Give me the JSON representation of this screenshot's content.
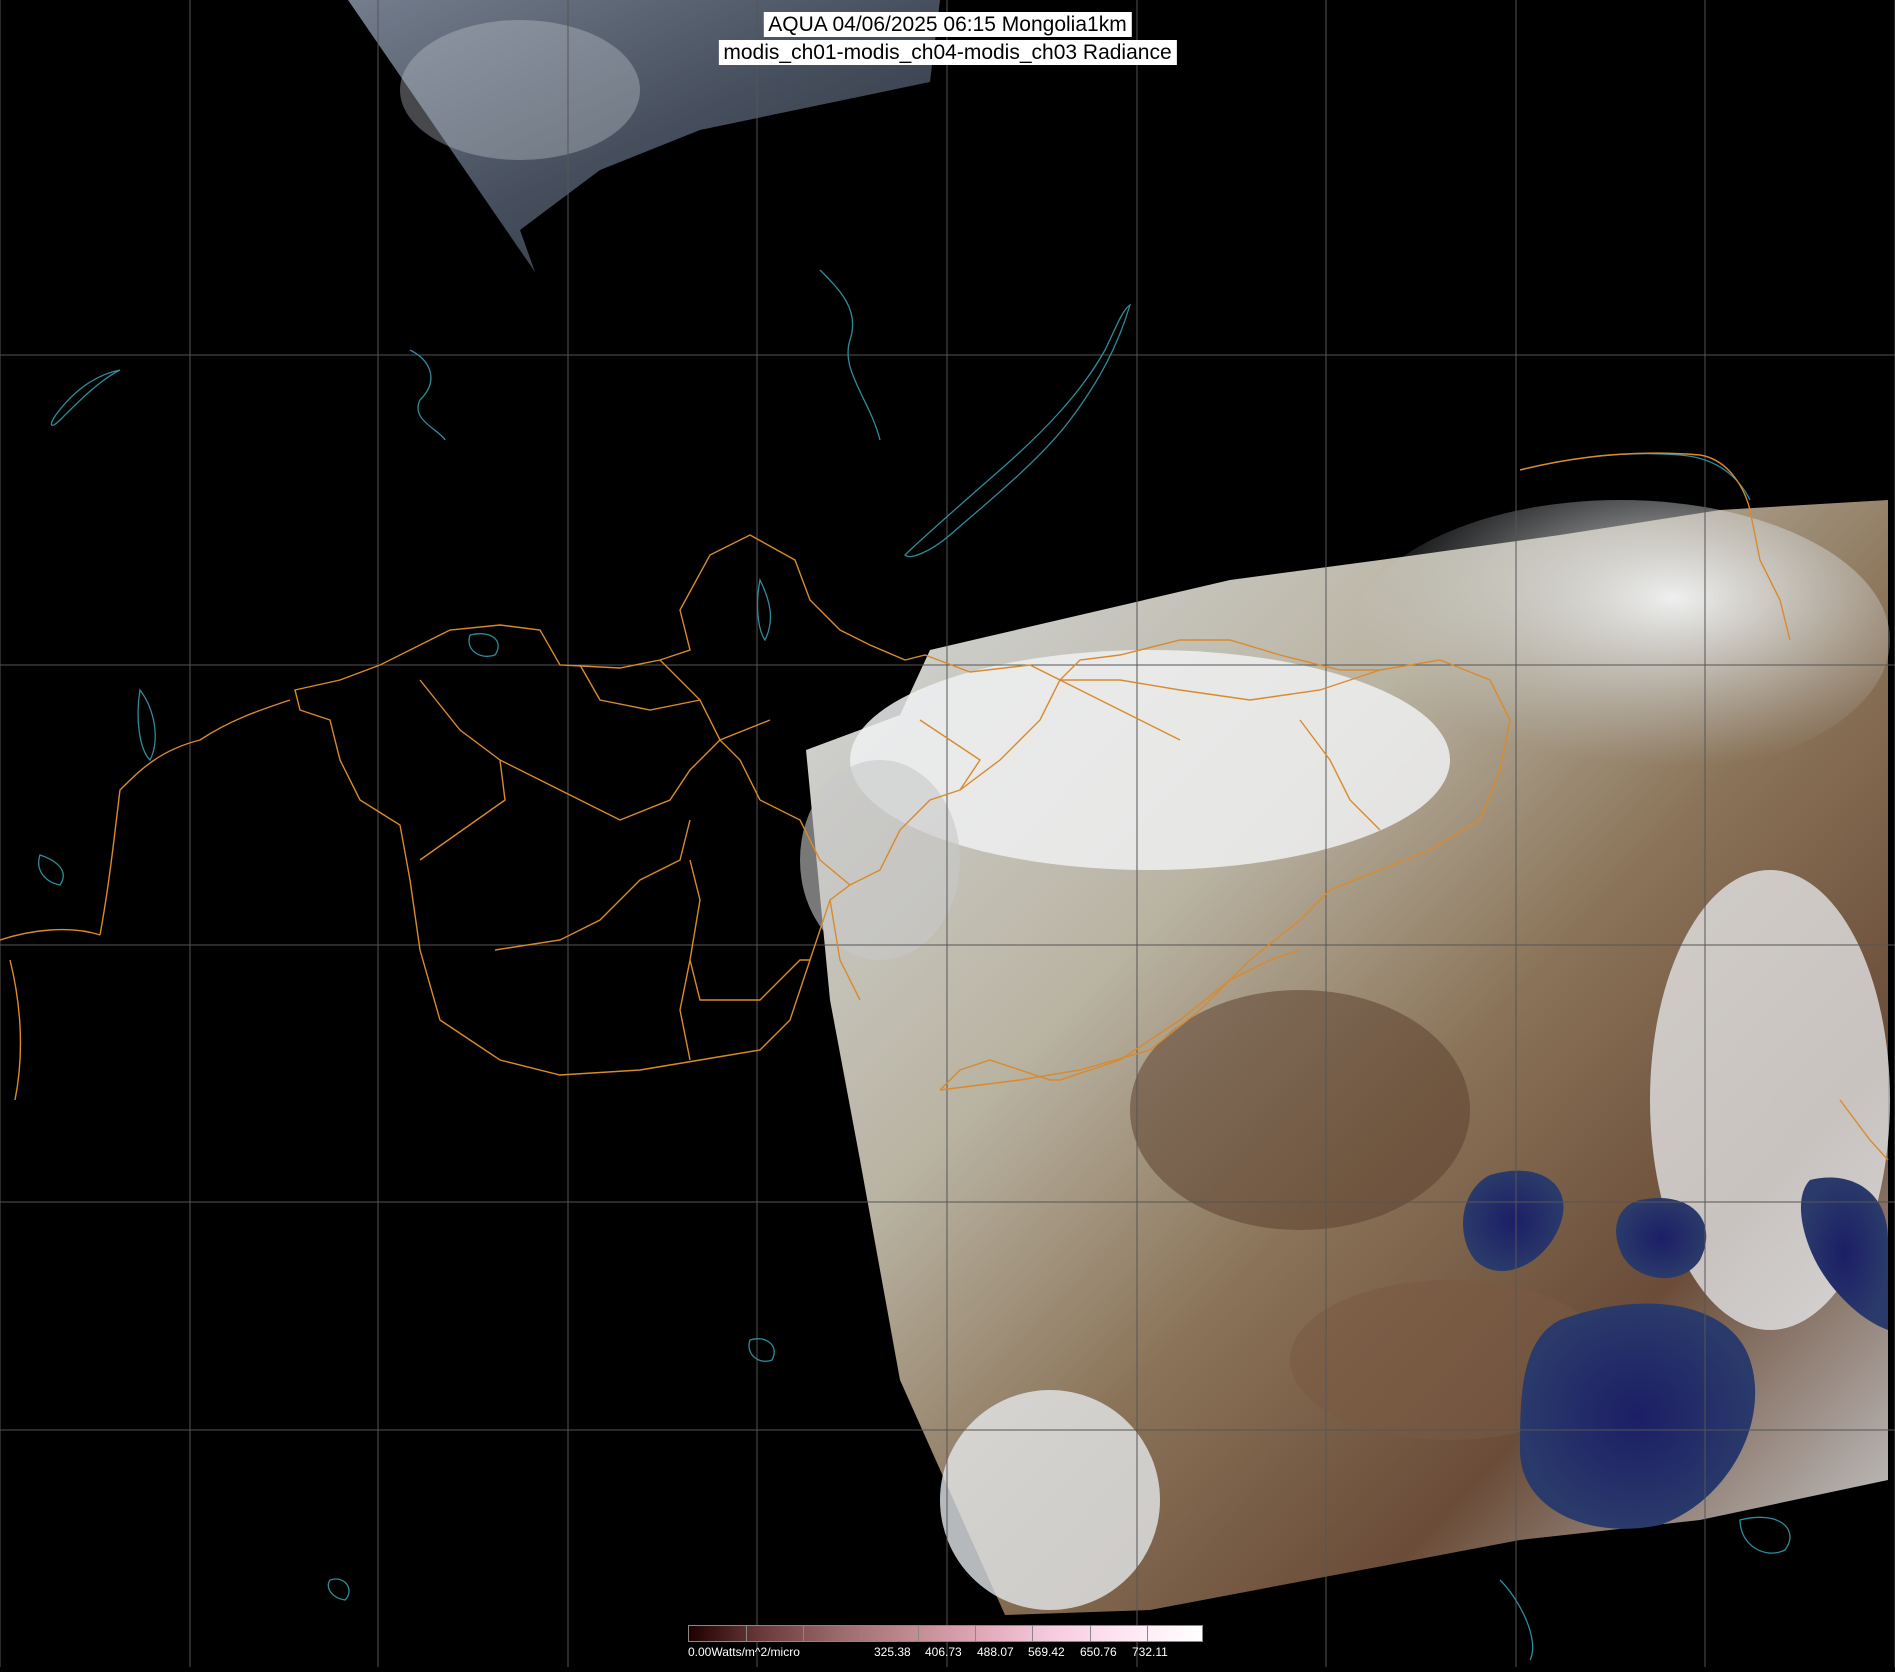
{
  "title": {
    "line1": "AQUA 04/06/2025 06:15 Mongolia1km",
    "line2": "modis_ch01-modis_ch04-modis_ch03 Radiance"
  },
  "colorbar": {
    "labels": [
      "0.00Watts/m^2/micro",
      "325.38",
      "406.73",
      "488.07",
      "569.42",
      "650.76",
      "732.11"
    ],
    "colors": [
      "#200000",
      "#6a3a3a",
      "#9a6a6a",
      "#c08a90",
      "#e0a8b8",
      "#f6cce0",
      "#ffe8f4",
      "#ffffff"
    ]
  },
  "colors": {
    "background": "#000000",
    "grid": "#555555",
    "borders": "#d98a2c",
    "coast_water": "#2e8c9a"
  },
  "layers": [
    "satellite-swath-north",
    "satellite-swath-main",
    "lat-lon-grid",
    "province-borders",
    "water-outlines"
  ]
}
